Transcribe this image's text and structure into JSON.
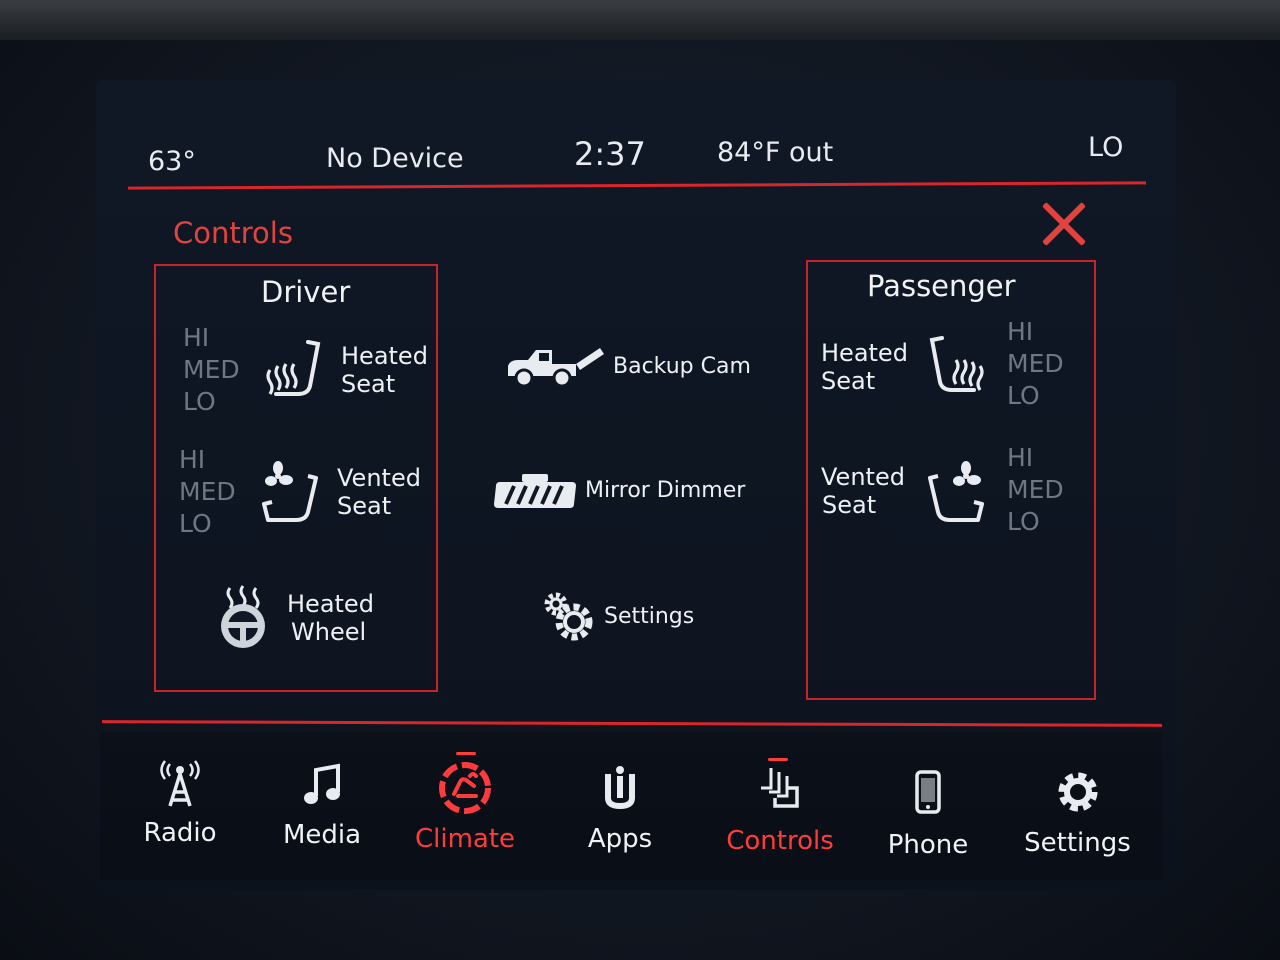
{
  "status_bar": {
    "interior_temp": "63°",
    "media_source": "No Device",
    "clock": "2:37",
    "outside_temp": "84°F out",
    "fan_level": "LO"
  },
  "page": {
    "title": "Controls"
  },
  "driver": {
    "title": "Driver",
    "heated_seat": {
      "levels": [
        "HI",
        "MED",
        "LO"
      ],
      "label_line1": "Heated",
      "label_line2": "Seat",
      "icon": "heated-seat-icon"
    },
    "vented_seat": {
      "levels": [
        "HI",
        "MED",
        "LO"
      ],
      "label_line1": "Vented",
      "label_line2": "Seat",
      "icon": "vented-seat-icon"
    },
    "heated_wheel": {
      "label_line1": "Heated",
      "label_line2": "Wheel",
      "icon": "heated-wheel-icon"
    }
  },
  "center_controls": {
    "backup_cam": {
      "label": "Backup Cam",
      "icon": "truck-tailgate-icon"
    },
    "mirror_dimmer": {
      "label": "Mirror Dimmer",
      "icon": "mirror-icon"
    },
    "settings": {
      "label": "Settings",
      "icon": "gears-icon"
    }
  },
  "passenger": {
    "title": "Passenger",
    "heated_seat": {
      "levels": [
        "HI",
        "MED",
        "LO"
      ],
      "label_line1": "Heated",
      "label_line2": "Seat",
      "icon": "heated-seat-icon"
    },
    "vented_seat": {
      "levels": [
        "HI",
        "MED",
        "LO"
      ],
      "label_line1": "Vented",
      "label_line2": "Seat",
      "icon": "vented-seat-icon"
    }
  },
  "nav": {
    "items": [
      {
        "label": "Radio",
        "icon": "radio-tower-icon",
        "active": false
      },
      {
        "label": "Media",
        "icon": "music-note-icon",
        "active": false
      },
      {
        "label": "Climate",
        "icon": "climate-icon",
        "active": true
      },
      {
        "label": "Apps",
        "icon": "apps-icon",
        "active": false
      },
      {
        "label": "Controls",
        "icon": "controls-icon",
        "active": true
      },
      {
        "label": "Phone",
        "icon": "phone-icon",
        "active": false
      },
      {
        "label": "Settings",
        "icon": "gear-icon",
        "active": false
      }
    ]
  },
  "colors": {
    "accent_red": "#d8262b",
    "text_light": "#eef1f4",
    "level_gray": "#6f7784",
    "background": "#0e1521"
  }
}
